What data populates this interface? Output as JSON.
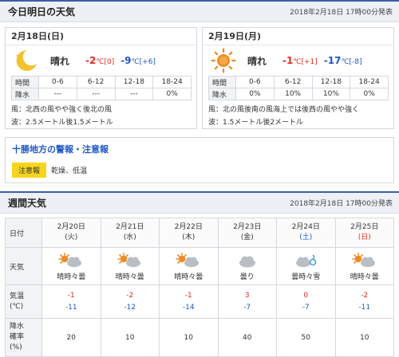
{
  "today_section": {
    "title": "今日明日の天気",
    "published": "2018年2月18日 17時00分発表",
    "days": [
      {
        "date": "2月18日(日)",
        "icon": "moon-star-icon",
        "weather": "晴れ",
        "high": "-2",
        "high_unit": "℃",
        "high_diff": "[0]",
        "low": "-9",
        "low_unit": "℃",
        "low_diff": "[+6]",
        "rain": {
          "label_time": "時間",
          "label_rain": "降水",
          "periods": [
            "0-6",
            "6-12",
            "12-18",
            "18-24"
          ],
          "values": [
            "---",
            "---",
            "---",
            "0%"
          ]
        },
        "wind": "風：北西の風やや強く後北の風",
        "wave": "波：2.5メートル後1.5メートル"
      },
      {
        "date": "2月19日(月)",
        "icon": "sun-icon",
        "weather": "晴れ",
        "high": "-1",
        "high_unit": "℃",
        "high_diff": "[+1]",
        "low": "-17",
        "low_unit": "℃",
        "low_diff": "[-8]",
        "rain": {
          "label_time": "時間",
          "label_rain": "降水",
          "periods": [
            "0-6",
            "6-12",
            "12-18",
            "18-24"
          ],
          "values": [
            "0%",
            "10%",
            "10%",
            "0%"
          ]
        },
        "wind": "風：北の風後南の風海上では後西の風やや強く",
        "wave": "波：1.5メートル後2メートル"
      }
    ]
  },
  "warnings": {
    "title": "十勝地方の警報・注意報",
    "badge": "注意報",
    "items": "乾燥、低温"
  },
  "weekly": {
    "title": "週間天気",
    "published": "2018年2月18日 17時00分発表",
    "row_labels": {
      "date": "日付",
      "weather": "天気",
      "temp": "気温\n(℃)",
      "pop": "降水\n確率\n(%)"
    },
    "days": [
      {
        "date": "2月20日",
        "dow": "(火)",
        "dow_type": "weekday",
        "icon": "sun-cloud-icon",
        "weather": "晴時々曇",
        "high": "-1",
        "low": "-11",
        "pop": "20"
      },
      {
        "date": "2月21日",
        "dow": "(水)",
        "dow_type": "weekday",
        "icon": "sun-cloud-icon",
        "weather": "晴時々曇",
        "high": "-2",
        "low": "-12",
        "pop": "10"
      },
      {
        "date": "2月22日",
        "dow": "(木)",
        "dow_type": "weekday",
        "icon": "sun-cloud-icon",
        "weather": "晴時々曇",
        "high": "-1",
        "low": "-14",
        "pop": "10"
      },
      {
        "date": "2月23日",
        "dow": "(金)",
        "dow_type": "weekday",
        "icon": "cloud-icon",
        "weather": "曇り",
        "high": "3",
        "low": "-7",
        "pop": "40"
      },
      {
        "date": "2月24日",
        "dow": "(土)",
        "dow_type": "saturday",
        "icon": "cloud-snow-icon",
        "weather": "曇時々雪",
        "high": "0",
        "low": "-7",
        "pop": "50"
      },
      {
        "date": "2月25日",
        "dow": "(日)",
        "dow_type": "sunday",
        "icon": "sun-cloud-icon",
        "weather": "晴時々曇",
        "high": "-2",
        "low": "-11",
        "pop": "10"
      }
    ]
  },
  "colors": {
    "accent": "#3a5fa8",
    "high": "#e02b20",
    "low": "#1f57c5",
    "badge": "#f7d51d"
  }
}
